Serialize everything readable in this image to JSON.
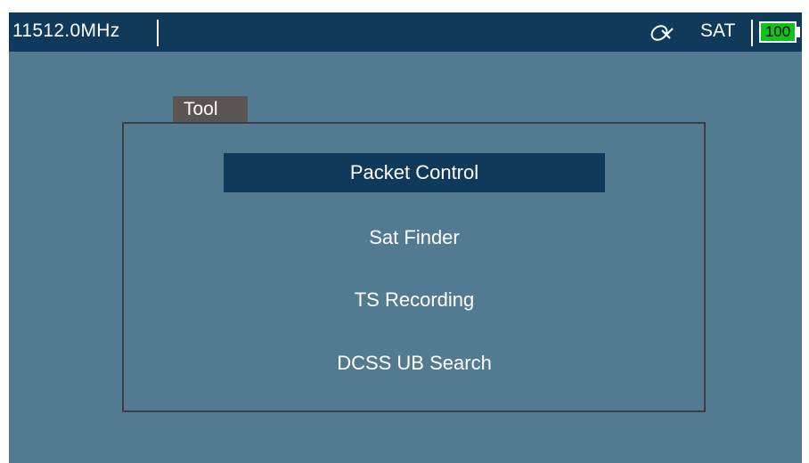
{
  "status_bar": {
    "frequency": "11512.0MHz",
    "mode_icon": "satellite-dish-icon",
    "mode": "SAT",
    "battery": "100",
    "battery_color": "#11c21b"
  },
  "tool_panel": {
    "title": "Tool",
    "items": [
      {
        "label": "Packet Control",
        "selected": true
      },
      {
        "label": "Sat Finder",
        "selected": false
      },
      {
        "label": "TS Recording",
        "selected": false
      },
      {
        "label": "DCSS UB Search",
        "selected": false
      }
    ]
  },
  "colors": {
    "background": "#527a91",
    "bar": "#0f3a5c",
    "highlight": "#0f3a5c",
    "tab": "#5a5453"
  }
}
